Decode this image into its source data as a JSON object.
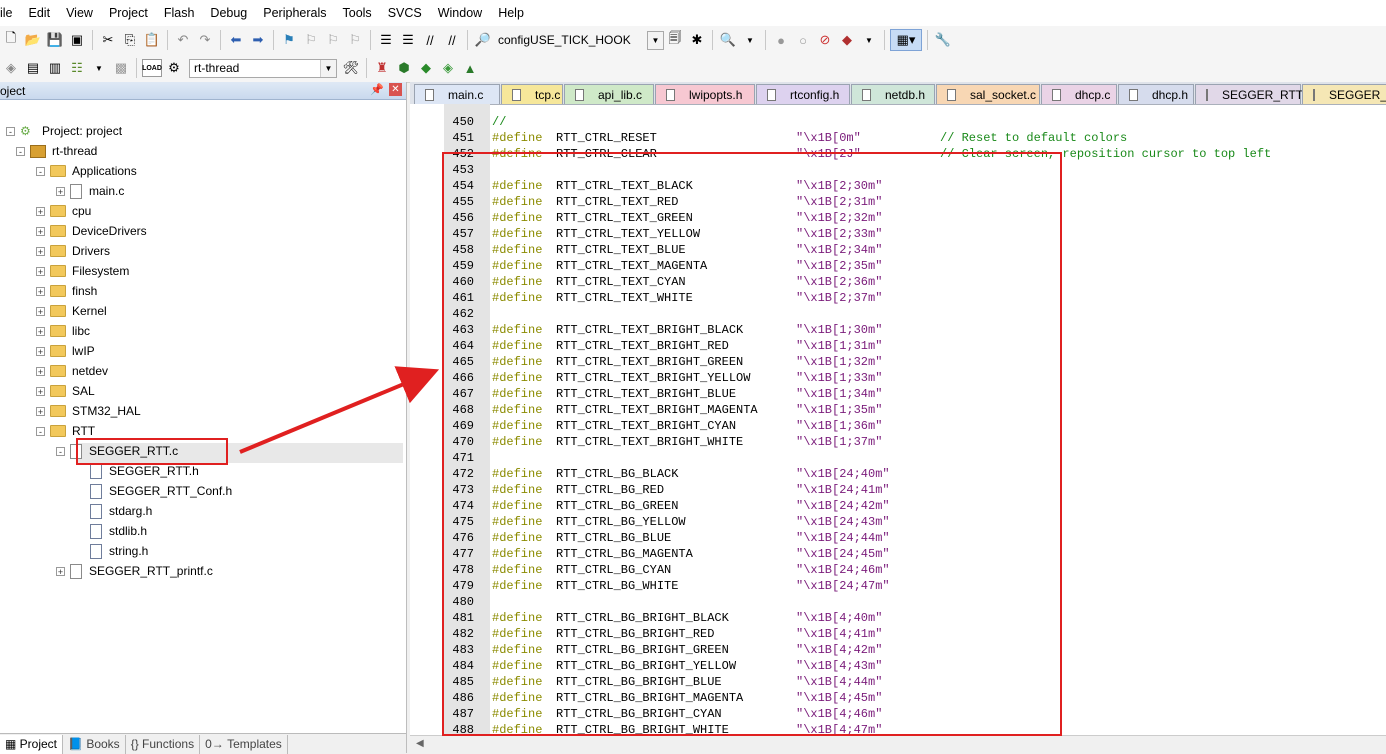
{
  "menu": [
    "ile",
    "Edit",
    "View",
    "Project",
    "Flash",
    "Debug",
    "Peripherals",
    "Tools",
    "SVCS",
    "Window",
    "Help"
  ],
  "toolbar": {
    "find_combo": "configUSE_TICK_HOOK",
    "target_combo": "rt-thread",
    "load_label": "LOAD"
  },
  "project_panel": {
    "title": "oject",
    "tree": [
      {
        "label": "Project: project",
        "kind": "project"
      },
      {
        "label": "rt-thread",
        "kind": "target"
      },
      {
        "label": "Applications",
        "kind": "folder"
      },
      {
        "label": "main.c",
        "kind": "file"
      },
      {
        "label": "cpu",
        "kind": "folder"
      },
      {
        "label": "DeviceDrivers",
        "kind": "folder"
      },
      {
        "label": "Drivers",
        "kind": "folder"
      },
      {
        "label": "Filesystem",
        "kind": "folder"
      },
      {
        "label": "finsh",
        "kind": "folder"
      },
      {
        "label": "Kernel",
        "kind": "folder"
      },
      {
        "label": "libc",
        "kind": "folder"
      },
      {
        "label": "lwIP",
        "kind": "folder"
      },
      {
        "label": "netdev",
        "kind": "folder"
      },
      {
        "label": "SAL",
        "kind": "folder"
      },
      {
        "label": "STM32_HAL",
        "kind": "folder"
      },
      {
        "label": "RTT",
        "kind": "folder"
      },
      {
        "label": "SEGGER_RTT.c",
        "kind": "file"
      },
      {
        "label": "SEGGER_RTT.h",
        "kind": "header",
        "selected": true
      },
      {
        "label": "SEGGER_RTT_Conf.h",
        "kind": "header"
      },
      {
        "label": "stdarg.h",
        "kind": "header"
      },
      {
        "label": "stdlib.h",
        "kind": "header"
      },
      {
        "label": "string.h",
        "kind": "header"
      },
      {
        "label": "SEGGER_RTT_printf.c",
        "kind": "file"
      }
    ],
    "bottom_tabs": [
      "Project",
      "Books",
      "Functions",
      "Templates"
    ]
  },
  "editor": {
    "tabs": [
      {
        "label": "main.c",
        "color": "#dde6f5"
      },
      {
        "label": "tcp.c",
        "color": "#f6e79a"
      },
      {
        "label": "api_lib.c",
        "color": "#cfe9c8"
      },
      {
        "label": "lwipopts.h",
        "color": "#f7c8d2"
      },
      {
        "label": "rtconfig.h",
        "color": "#ddd2ef"
      },
      {
        "label": "netdb.h",
        "color": "#cfe6d9"
      },
      {
        "label": "sal_socket.c",
        "color": "#f8d7b4"
      },
      {
        "label": "dhcp.c",
        "color": "#ead3e6"
      },
      {
        "label": "dhcp.h",
        "color": "#d6dced"
      },
      {
        "label": "SEGGER_RTT.c",
        "color": "#e1d8e8"
      },
      {
        "label": "SEGGER_RT",
        "color": "#f5e7b5"
      }
    ],
    "lines": [
      {
        "num": "450",
        "define": "",
        "name": "",
        "value": "",
        "comment": "//"
      },
      {
        "num": "451",
        "define": "#define",
        "name": "RTT_CTRL_RESET",
        "value": "\"\\x1B[0m\"",
        "comment": "// Reset to default colors"
      },
      {
        "num": "452",
        "define": "#define",
        "name": "RTT_CTRL_CLEAR",
        "value": "\"\\x1B[2J\"",
        "comment": "// Clear screen, reposition cursor to top left"
      },
      {
        "num": "453",
        "define": "",
        "name": "",
        "value": "",
        "comment": ""
      },
      {
        "num": "454",
        "define": "#define",
        "name": "RTT_CTRL_TEXT_BLACK",
        "value": "\"\\x1B[2;30m\"",
        "comment": ""
      },
      {
        "num": "455",
        "define": "#define",
        "name": "RTT_CTRL_TEXT_RED",
        "value": "\"\\x1B[2;31m\"",
        "comment": ""
      },
      {
        "num": "456",
        "define": "#define",
        "name": "RTT_CTRL_TEXT_GREEN",
        "value": "\"\\x1B[2;32m\"",
        "comment": ""
      },
      {
        "num": "457",
        "define": "#define",
        "name": "RTT_CTRL_TEXT_YELLOW",
        "value": "\"\\x1B[2;33m\"",
        "comment": ""
      },
      {
        "num": "458",
        "define": "#define",
        "name": "RTT_CTRL_TEXT_BLUE",
        "value": "\"\\x1B[2;34m\"",
        "comment": ""
      },
      {
        "num": "459",
        "define": "#define",
        "name": "RTT_CTRL_TEXT_MAGENTA",
        "value": "\"\\x1B[2;35m\"",
        "comment": ""
      },
      {
        "num": "460",
        "define": "#define",
        "name": "RTT_CTRL_TEXT_CYAN",
        "value": "\"\\x1B[2;36m\"",
        "comment": ""
      },
      {
        "num": "461",
        "define": "#define",
        "name": "RTT_CTRL_TEXT_WHITE",
        "value": "\"\\x1B[2;37m\"",
        "comment": ""
      },
      {
        "num": "462",
        "define": "",
        "name": "",
        "value": "",
        "comment": ""
      },
      {
        "num": "463",
        "define": "#define",
        "name": "RTT_CTRL_TEXT_BRIGHT_BLACK",
        "value": "\"\\x1B[1;30m\"",
        "comment": ""
      },
      {
        "num": "464",
        "define": "#define",
        "name": "RTT_CTRL_TEXT_BRIGHT_RED",
        "value": "\"\\x1B[1;31m\"",
        "comment": ""
      },
      {
        "num": "465",
        "define": "#define",
        "name": "RTT_CTRL_TEXT_BRIGHT_GREEN",
        "value": "\"\\x1B[1;32m\"",
        "comment": ""
      },
      {
        "num": "466",
        "define": "#define",
        "name": "RTT_CTRL_TEXT_BRIGHT_YELLOW",
        "value": "\"\\x1B[1;33m\"",
        "comment": ""
      },
      {
        "num": "467",
        "define": "#define",
        "name": "RTT_CTRL_TEXT_BRIGHT_BLUE",
        "value": "\"\\x1B[1;34m\"",
        "comment": ""
      },
      {
        "num": "468",
        "define": "#define",
        "name": "RTT_CTRL_TEXT_BRIGHT_MAGENTA",
        "value": "\"\\x1B[1;35m\"",
        "comment": ""
      },
      {
        "num": "469",
        "define": "#define",
        "name": "RTT_CTRL_TEXT_BRIGHT_CYAN",
        "value": "\"\\x1B[1;36m\"",
        "comment": ""
      },
      {
        "num": "470",
        "define": "#define",
        "name": "RTT_CTRL_TEXT_BRIGHT_WHITE",
        "value": "\"\\x1B[1;37m\"",
        "comment": ""
      },
      {
        "num": "471",
        "define": "",
        "name": "",
        "value": "",
        "comment": ""
      },
      {
        "num": "472",
        "define": "#define",
        "name": "RTT_CTRL_BG_BLACK",
        "value": "\"\\x1B[24;40m\"",
        "comment": ""
      },
      {
        "num": "473",
        "define": "#define",
        "name": "RTT_CTRL_BG_RED",
        "value": "\"\\x1B[24;41m\"",
        "comment": ""
      },
      {
        "num": "474",
        "define": "#define",
        "name": "RTT_CTRL_BG_GREEN",
        "value": "\"\\x1B[24;42m\"",
        "comment": ""
      },
      {
        "num": "475",
        "define": "#define",
        "name": "RTT_CTRL_BG_YELLOW",
        "value": "\"\\x1B[24;43m\"",
        "comment": ""
      },
      {
        "num": "476",
        "define": "#define",
        "name": "RTT_CTRL_BG_BLUE",
        "value": "\"\\x1B[24;44m\"",
        "comment": ""
      },
      {
        "num": "477",
        "define": "#define",
        "name": "RTT_CTRL_BG_MAGENTA",
        "value": "\"\\x1B[24;45m\"",
        "comment": ""
      },
      {
        "num": "478",
        "define": "#define",
        "name": "RTT_CTRL_BG_CYAN",
        "value": "\"\\x1B[24;46m\"",
        "comment": ""
      },
      {
        "num": "479",
        "define": "#define",
        "name": "RTT_CTRL_BG_WHITE",
        "value": "\"\\x1B[24;47m\"",
        "comment": ""
      },
      {
        "num": "480",
        "define": "",
        "name": "",
        "value": "",
        "comment": ""
      },
      {
        "num": "481",
        "define": "#define",
        "name": "RTT_CTRL_BG_BRIGHT_BLACK",
        "value": "\"\\x1B[4;40m\"",
        "comment": ""
      },
      {
        "num": "482",
        "define": "#define",
        "name": "RTT_CTRL_BG_BRIGHT_RED",
        "value": "\"\\x1B[4;41m\"",
        "comment": ""
      },
      {
        "num": "483",
        "define": "#define",
        "name": "RTT_CTRL_BG_BRIGHT_GREEN",
        "value": "\"\\x1B[4;42m\"",
        "comment": ""
      },
      {
        "num": "484",
        "define": "#define",
        "name": "RTT_CTRL_BG_BRIGHT_YELLOW",
        "value": "\"\\x1B[4;43m\"",
        "comment": ""
      },
      {
        "num": "485",
        "define": "#define",
        "name": "RTT_CTRL_BG_BRIGHT_BLUE",
        "value": "\"\\x1B[4;44m\"",
        "comment": ""
      },
      {
        "num": "486",
        "define": "#define",
        "name": "RTT_CTRL_BG_BRIGHT_MAGENTA",
        "value": "\"\\x1B[4;45m\"",
        "comment": ""
      },
      {
        "num": "487",
        "define": "#define",
        "name": "RTT_CTRL_BG_BRIGHT_CYAN",
        "value": "\"\\x1B[4;46m\"",
        "comment": ""
      },
      {
        "num": "488",
        "define": "#define",
        "name": "RTT_CTRL_BG_BRIGHT_WHITE",
        "value": "\"\\x1B[4;47m\"",
        "comment": ""
      }
    ]
  },
  "colors": {
    "highlight_red": "#e02020",
    "define_keyword": "#8b8b00",
    "string_literal": "#7a1b7a",
    "comment": "#1a8a1a"
  }
}
